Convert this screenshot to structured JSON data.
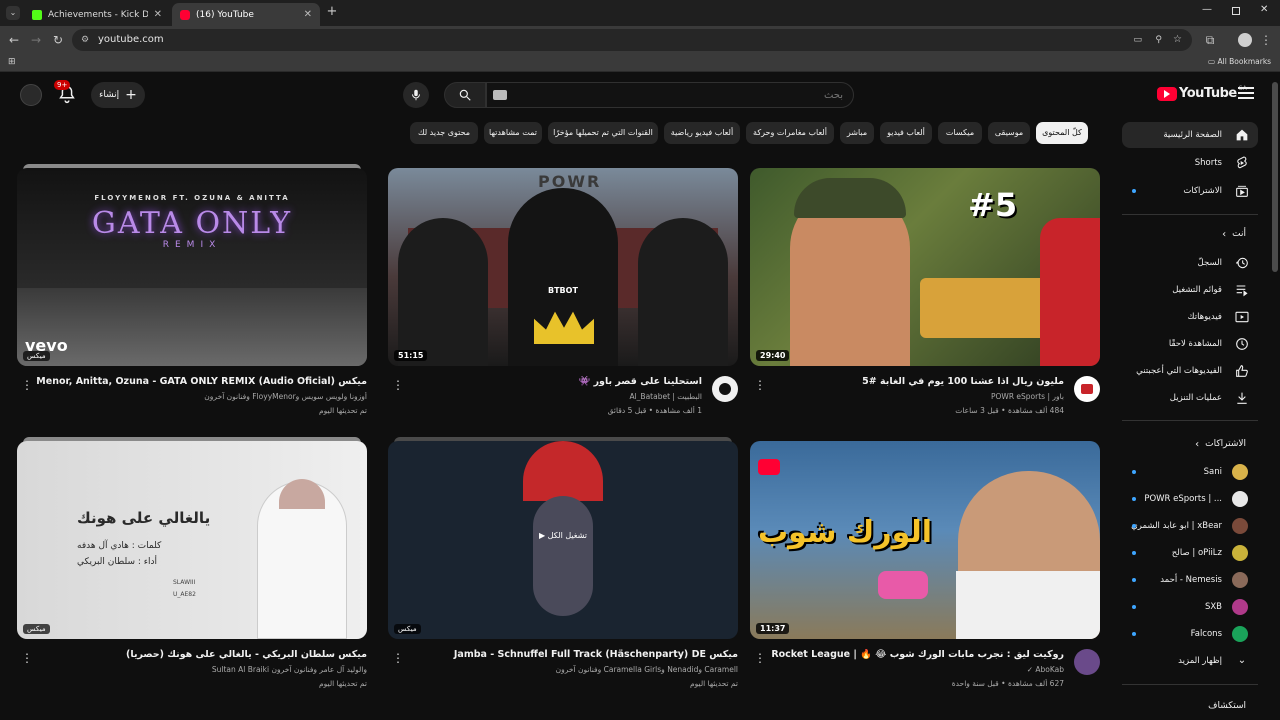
{
  "browser": {
    "tabs": [
      {
        "label": "Achievements - Kick Dashboard",
        "active": false
      },
      {
        "label": "(16) YouTube",
        "active": true
      }
    ],
    "url": "youtube.com",
    "bookmarks_label": "All Bookmarks"
  },
  "masthead": {
    "logo_text": "YouTube",
    "region": "SA",
    "search_placeholder": "بحث",
    "create_label": "إنشاء",
    "notifications_badge": "9+"
  },
  "chips": [
    {
      "label": "كلّ المحتوى",
      "selected": true
    },
    {
      "label": "موسيقى",
      "selected": false
    },
    {
      "label": "ميكسات",
      "selected": false
    },
    {
      "label": "ألعاب فيديو",
      "selected": false
    },
    {
      "label": "مباشر",
      "selected": false
    },
    {
      "label": "ألعاب مغامرات وحركة",
      "selected": false
    },
    {
      "label": "ألعاب فيديو رياضية",
      "selected": false
    },
    {
      "label": "القنوات التي تم تحميلها مؤخرًا",
      "selected": false
    },
    {
      "label": "تمت مشاهدتها",
      "selected": false
    },
    {
      "label": "محتوى جديد لك",
      "selected": false
    }
  ],
  "sidebar": {
    "main": [
      {
        "label": "الصفحة الرئيسية",
        "icon": "home-icon",
        "active": true
      },
      {
        "label": "Shorts",
        "icon": "shorts-icon",
        "active": false
      },
      {
        "label": "الاشتراكات",
        "icon": "subscriptions-icon",
        "active": false
      }
    ],
    "you_header": "أنت",
    "you": [
      {
        "label": "السجلّ",
        "icon": "history-icon"
      },
      {
        "label": "قوائم التشغيل",
        "icon": "playlists-icon"
      },
      {
        "label": "فيديوهاتك",
        "icon": "your-videos-icon"
      },
      {
        "label": "المشاهدة لاحقًا",
        "icon": "watch-later-icon"
      },
      {
        "label": "الفيديوهات التي أعجبتني",
        "icon": "liked-icon"
      },
      {
        "label": "عمليات التنزيل",
        "icon": "download-icon"
      }
    ],
    "subs_header": "الاشتراكات",
    "subs": [
      {
        "label": "Sani",
        "color": "#d8b24a"
      },
      {
        "label": "POWR eSports | ...",
        "color": "#e8e8e8"
      },
      {
        "label": "ابو عابد الشمري | xBear",
        "color": "#7a4a3a"
      },
      {
        "label": "صالح | oPiiLz",
        "color": "#c9b23a"
      },
      {
        "label": "أحمد - Nemesis",
        "color": "#8a6a5a"
      },
      {
        "label": "SXB",
        "color": "#b03a8a"
      },
      {
        "label": "Falcons",
        "color": "#1aa35a"
      }
    ],
    "show_more": "إظهار المزيد",
    "explore_header": "استكشاف"
  },
  "videos": [
    {
      "title": "مليون ريال اذا عشنا 100 يوم في الغابة #5",
      "channel": "باور | POWR eSports",
      "stats": "484 ألف مشاهدة • قبل 3 ساعات",
      "duration": "29:40",
      "thumb_text": "#5",
      "avatar_color": "#ffffff"
    },
    {
      "title": "استحلينا على قصر باور 👾",
      "channel": "البطبيت | Al_Batabet",
      "stats": "1 ألف مشاهدة • قبل 5 دقائق",
      "duration": "51:15",
      "thumb_text": "POWR",
      "thumb_subtext": "BTBOT",
      "avatar_color": "#f0f0f0"
    },
    {
      "title": "ميكس FloyyMenor, Anitta, Ozuna - GATA ONLY REMIX (Audio Oficial)",
      "channel": "أوزونا ولويس سويس وFloyyMenor وفنانون آخرون",
      "stats": "تم تحديثها اليوم",
      "mix_label": "ميكس",
      "thumb_text": "GATA ONLY",
      "thumb_subtext": "REMIX",
      "thumb_top": "FLOYYMENOR FT. OZUNA & ANITTA",
      "thumb_brand": "vevo"
    },
    {
      "title": "روكيت ليق : نجرب مابات الورك شوب 😂 🔥 | Rocket League",
      "channel": "AboKab ✓",
      "stats": "627 ألف مشاهدة • قبل سنة واحدة",
      "duration": "11:37",
      "thumb_text": "الورك شوب",
      "avatar_color": "#6a4a8a"
    },
    {
      "title": "ميكس Jamba - Schnuffel Full Track (Häschenparty) DE",
      "channel": "Caramell وNenadid وCaramella Girls وفنانون آخرون",
      "stats": "تم تحديثها اليوم",
      "mix_label": "ميكس",
      "play_label": "تشغيل الكل"
    },
    {
      "title": "ميكس سلطان البريكي - يالغالي على هونك (حصريا)",
      "channel": "والوليد آل عامر وفنانون آخرون Sultan Al Braiki",
      "stats": "تم تحديثها اليوم",
      "mix_label": "ميكس",
      "thumb_text": "يالغالي على هونك",
      "thumb_lines": [
        "كلمات : هادي آل هدفه",
        "أداء : سلطان البريكي"
      ],
      "thumb_tag": "SLAWIII",
      "thumb_tag2": "U_AE82"
    }
  ]
}
